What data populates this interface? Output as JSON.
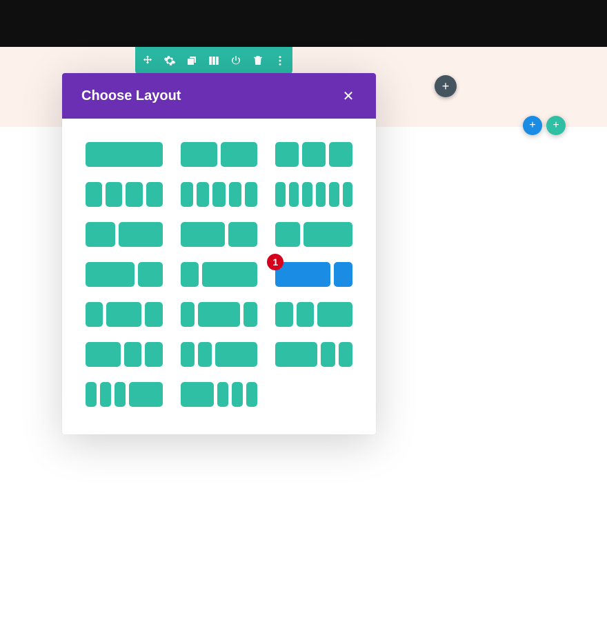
{
  "modal": {
    "title": "Choose Layout",
    "close_glyph": "✕"
  },
  "badge": {
    "number": "1"
  },
  "plus_glyph": "+",
  "toolbar": {
    "icons": [
      "move",
      "settings",
      "duplicate",
      "columns",
      "power",
      "delete",
      "more"
    ]
  },
  "layouts": [
    {
      "id": "1",
      "fracs": [
        1
      ]
    },
    {
      "id": "1-2-1-2",
      "fracs": [
        1,
        1
      ]
    },
    {
      "id": "1-3-1-3-1-3",
      "fracs": [
        1,
        1,
        1
      ]
    },
    {
      "id": "1-4x4",
      "fracs": [
        1,
        1,
        1,
        1
      ]
    },
    {
      "id": "1-5x5",
      "fracs": [
        1,
        1,
        1,
        1,
        1
      ]
    },
    {
      "id": "1-6x6",
      "fracs": [
        1,
        1,
        1,
        1,
        1,
        1
      ]
    },
    {
      "id": "2-5-3-5",
      "fracs": [
        2,
        3
      ]
    },
    {
      "id": "3-5-2-5",
      "fracs": [
        3,
        2
      ]
    },
    {
      "id": "1-3-2-3",
      "fracs": [
        1,
        2
      ]
    },
    {
      "id": "2-3-1-3",
      "fracs": [
        2,
        1
      ]
    },
    {
      "id": "1-4-3-4",
      "fracs": [
        1,
        3
      ]
    },
    {
      "id": "3-4-1-4",
      "fracs": [
        3,
        1
      ],
      "selected": true
    },
    {
      "id": "1-4-1-2-1-4",
      "fracs": [
        1,
        2,
        1
      ]
    },
    {
      "id": "1-5-3-5-1-5",
      "fracs": [
        1,
        3,
        1
      ]
    },
    {
      "id": "1-4-1-4-1-2",
      "fracs": [
        1,
        1,
        2
      ]
    },
    {
      "id": "1-2-1-4-1-4",
      "fracs": [
        2,
        1,
        1
      ]
    },
    {
      "id": "1-5-1-5-3-5",
      "fracs": [
        1,
        1,
        3
      ]
    },
    {
      "id": "3-5-1-5-1-5",
      "fracs": [
        3,
        1,
        1
      ]
    },
    {
      "id": "1-6-1-6-1-6-1-2",
      "fracs": [
        1,
        1,
        1,
        3
      ]
    },
    {
      "id": "1-2-1-6-1-6-1-6",
      "fracs": [
        3,
        1,
        1,
        1
      ]
    }
  ]
}
